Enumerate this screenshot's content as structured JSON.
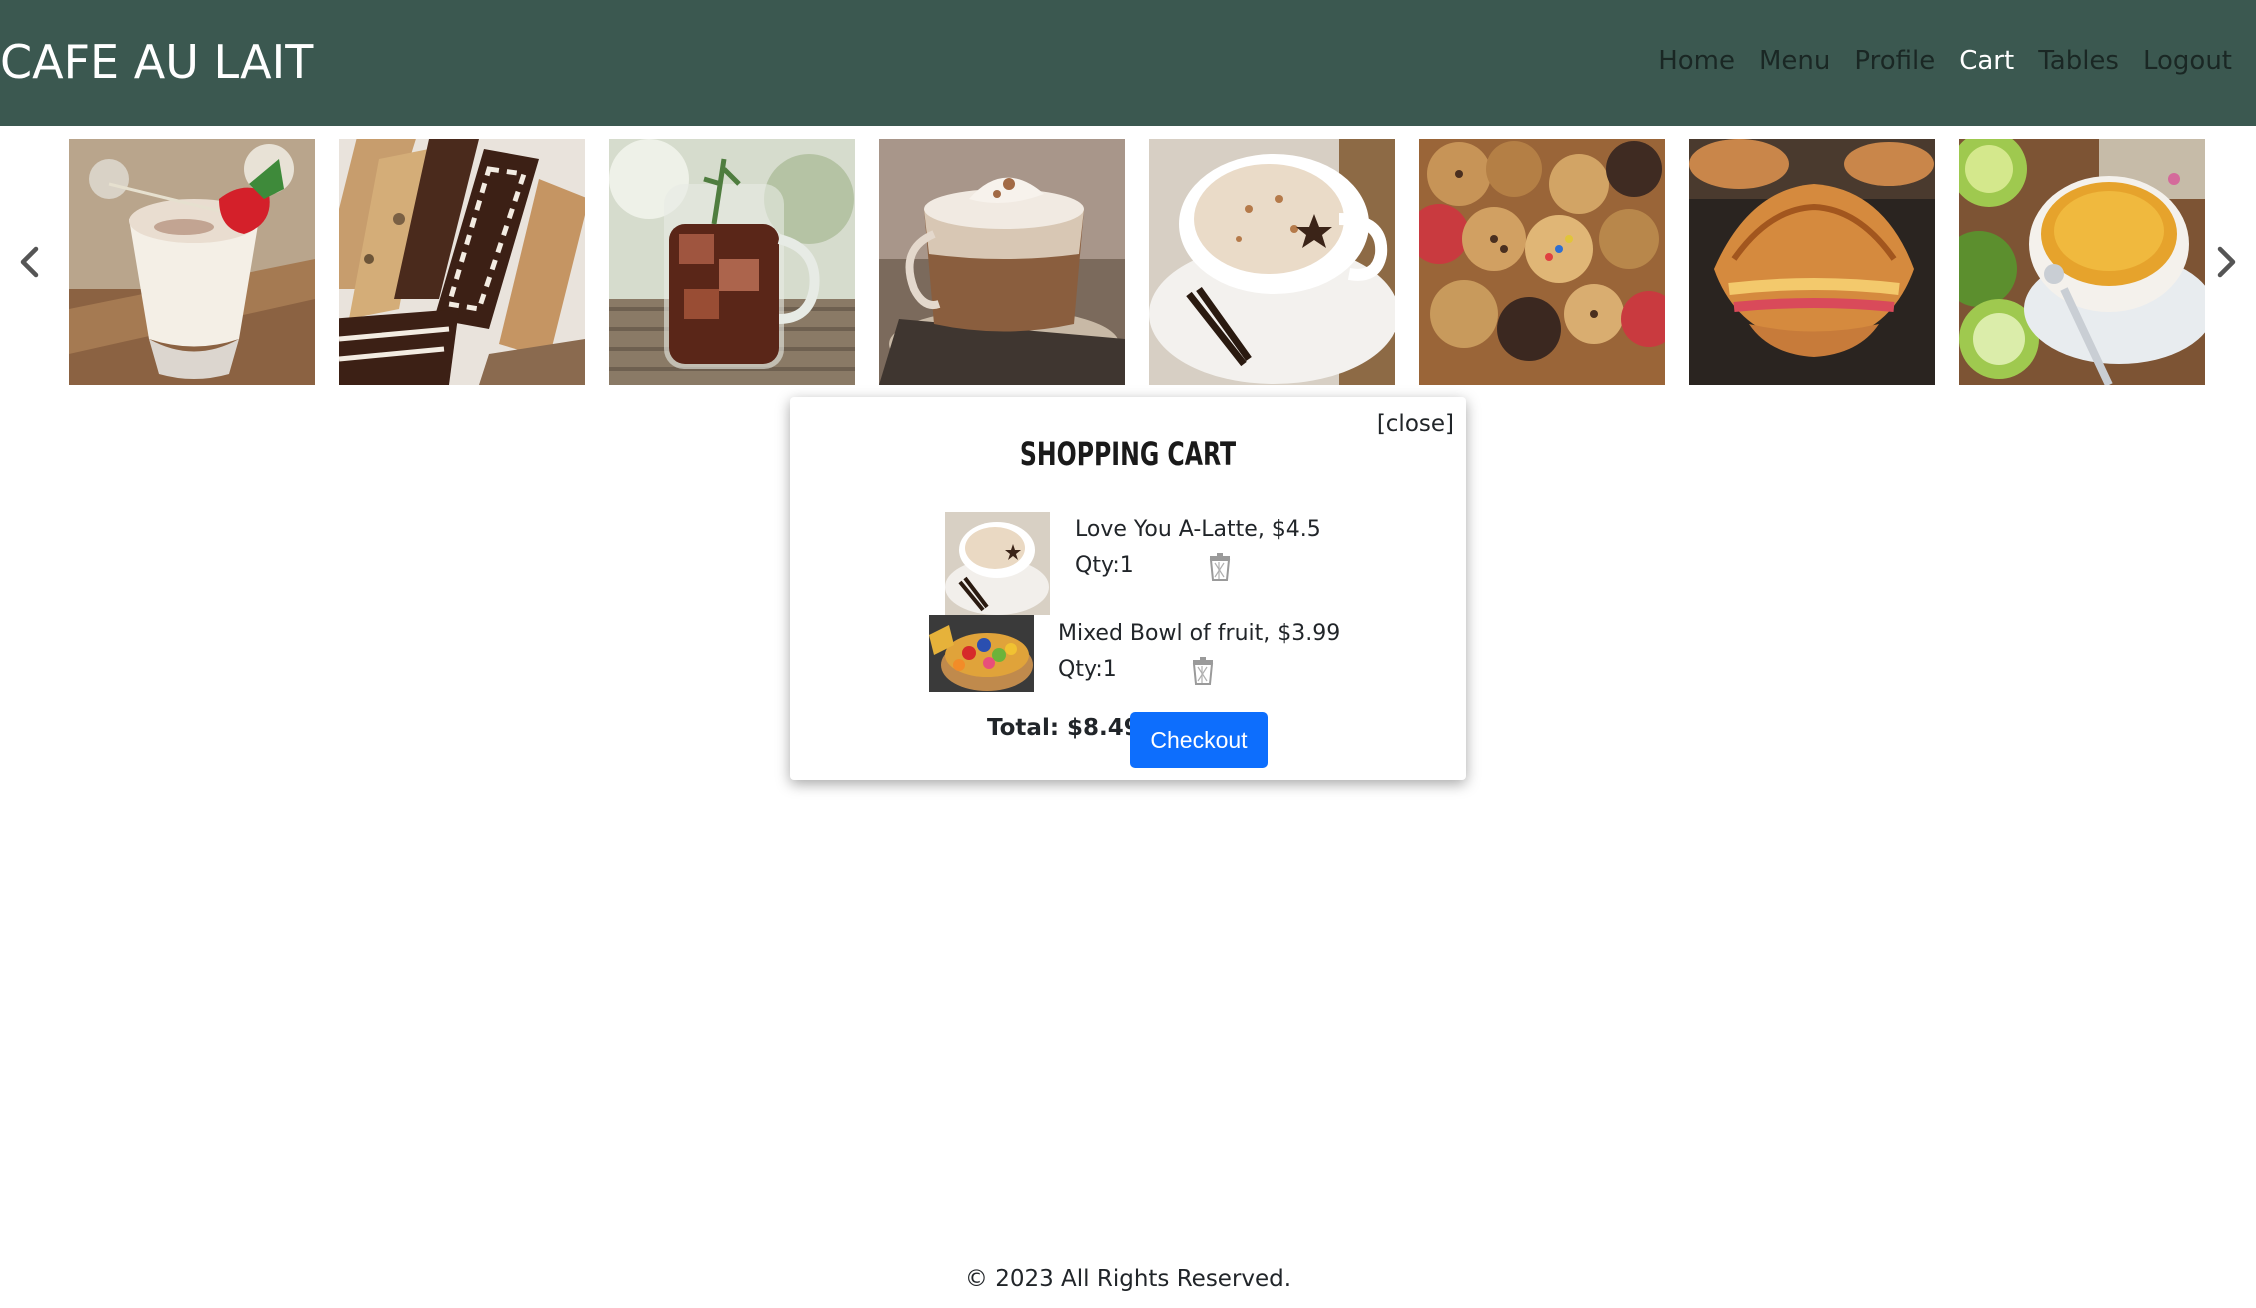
{
  "header": {
    "brand": "CAFE AU LAIT",
    "nav": [
      {
        "label": "Home",
        "active": false
      },
      {
        "label": "Menu",
        "active": false
      },
      {
        "label": "Profile",
        "active": false
      },
      {
        "label": "Cart",
        "active": true
      },
      {
        "label": "Tables",
        "active": false
      },
      {
        "label": "Logout",
        "active": false
      }
    ],
    "bg_color": "#3b5850"
  },
  "carousel": {
    "items": [
      {
        "name": "strawberry-white-mocha-photo"
      },
      {
        "name": "chocolate-biscotti-photo"
      },
      {
        "name": "iced-tea-mason-jar-photo"
      },
      {
        "name": "cappuccino-glass-mug-photo"
      },
      {
        "name": "vanilla-latte-cup-photo"
      },
      {
        "name": "assorted-cookies-photo"
      },
      {
        "name": "croissant-sandwich-photo"
      },
      {
        "name": "bergamot-tea-cup-photo"
      }
    ],
    "prev_icon": "chevron-left-icon",
    "next_icon": "chevron-right-icon"
  },
  "cart": {
    "title": "SHOPPING CART",
    "close_label": "[close]",
    "items": [
      {
        "name": "Love You A-Latte, $4.5",
        "qty": "Qty:1"
      },
      {
        "name": "Mixed Bowl of fruit, $3.99",
        "qty": "Qty:1"
      }
    ],
    "total": "Total: $8.49",
    "checkout_label": "Checkout",
    "checkout_color": "#0d6efd"
  },
  "footer": {
    "text": "© 2023 All Rights Reserved."
  }
}
